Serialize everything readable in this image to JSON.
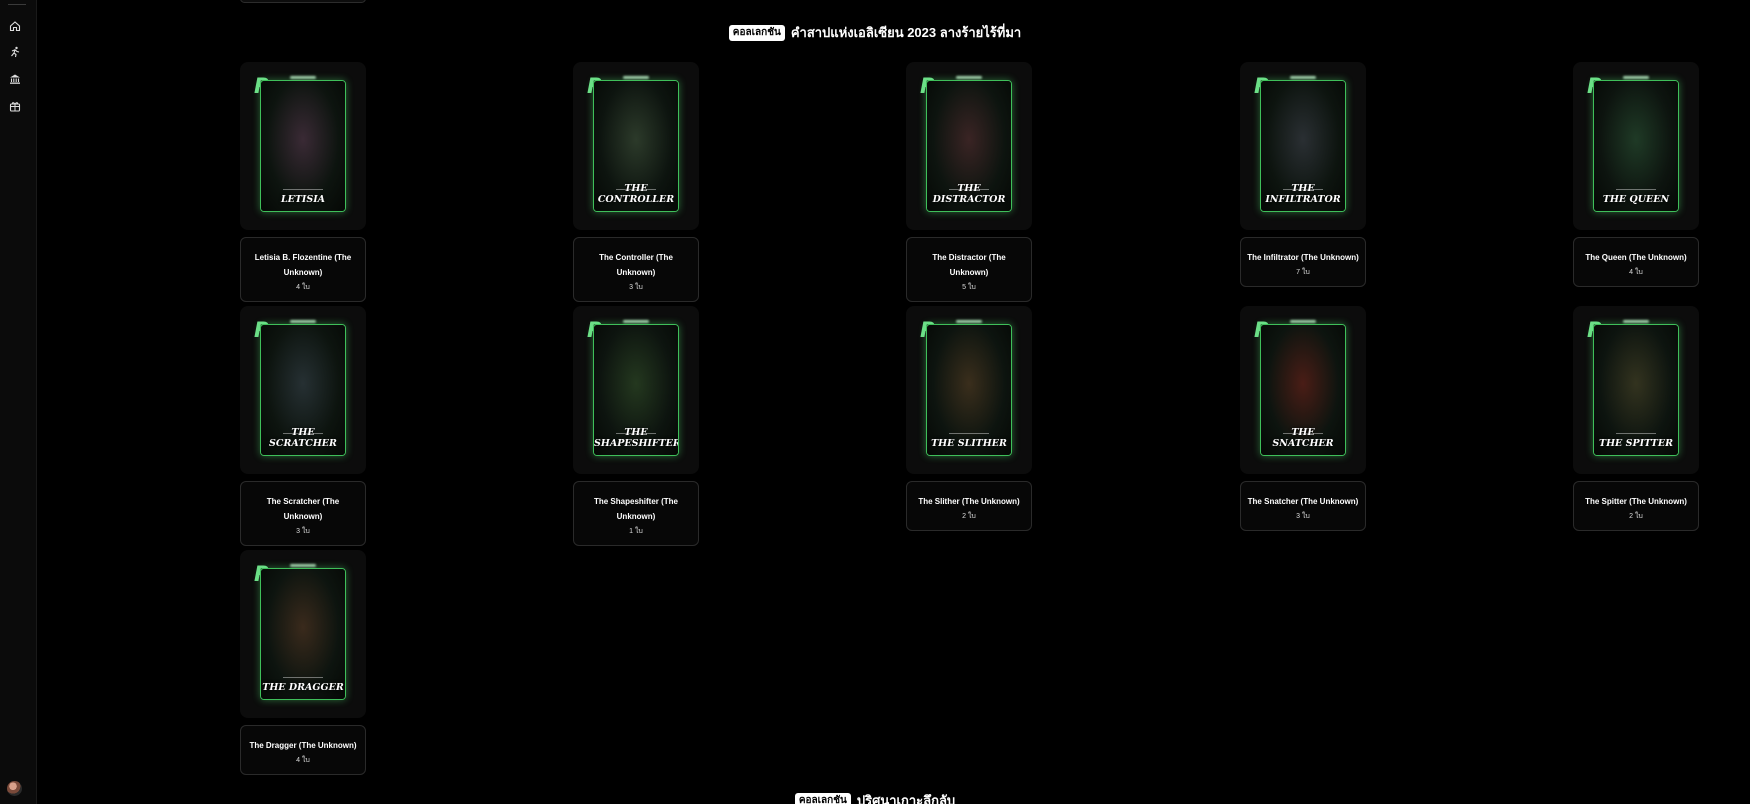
{
  "sections": [
    {
      "badge": "คอลเลกชัน",
      "title": "คำสาปแห่งเอลิเซียน 2023 ลางร้ายไร้ที่มา"
    },
    {
      "badge": "คอลเลกชัน",
      "title": "ปริศนาเกาะลึกลับ"
    }
  ],
  "cards": [
    {
      "art_label": "LETISIA",
      "title": "Letisia B. Flozentine (The Unknown)",
      "count": "4 ใบ",
      "tint": "#3a2a35"
    },
    {
      "art_label": "THE CONTROLLER",
      "title": "The Controller (The Unknown)",
      "count": "3 ใบ",
      "tint": "#2c3a2a"
    },
    {
      "art_label": "THE DISTRACTOR",
      "title": "The Distractor (The Unknown)",
      "count": "5 ใบ",
      "tint": "#3a2424"
    },
    {
      "art_label": "THE INFILTRATOR",
      "title": "The Infiltrator (The Unknown)",
      "count": "7 ใบ",
      "tint": "#2a2f33"
    },
    {
      "art_label": "THE QUEEN",
      "title": "The Queen (The Unknown)",
      "count": "4 ใบ",
      "tint": "#1f3a26"
    },
    {
      "art_label": "THE SCRATCHER",
      "title": "The Scratcher (The Unknown)",
      "count": "3 ใบ",
      "tint": "#263033"
    },
    {
      "art_label": "THE SHAPESHIFTER",
      "title": "The Shapeshifter (The Unknown)",
      "count": "1 ใบ",
      "tint": "#24381f"
    },
    {
      "art_label": "THE SLITHER",
      "title": "The Slither (The Unknown)",
      "count": "2 ใบ",
      "tint": "#3a2e1c"
    },
    {
      "art_label": "THE SNATCHER",
      "title": "The Snatcher (The Unknown)",
      "count": "3 ใบ",
      "tint": "#4a1d16"
    },
    {
      "art_label": "THE SPITTER",
      "title": "The Spitter (The Unknown)",
      "count": "2 ใบ",
      "tint": "#33331f"
    },
    {
      "art_label": "THE DRAGGER",
      "title": "The Dragger (The Unknown)",
      "count": "4 ใบ",
      "tint": "#3a2a1c"
    }
  ],
  "sidebar": {
    "icons": [
      "home-icon",
      "runner-icon",
      "bank-icon",
      "gift-icon"
    ]
  },
  "colors": {
    "accent": "#3fbf5a",
    "background": "#000000"
  }
}
